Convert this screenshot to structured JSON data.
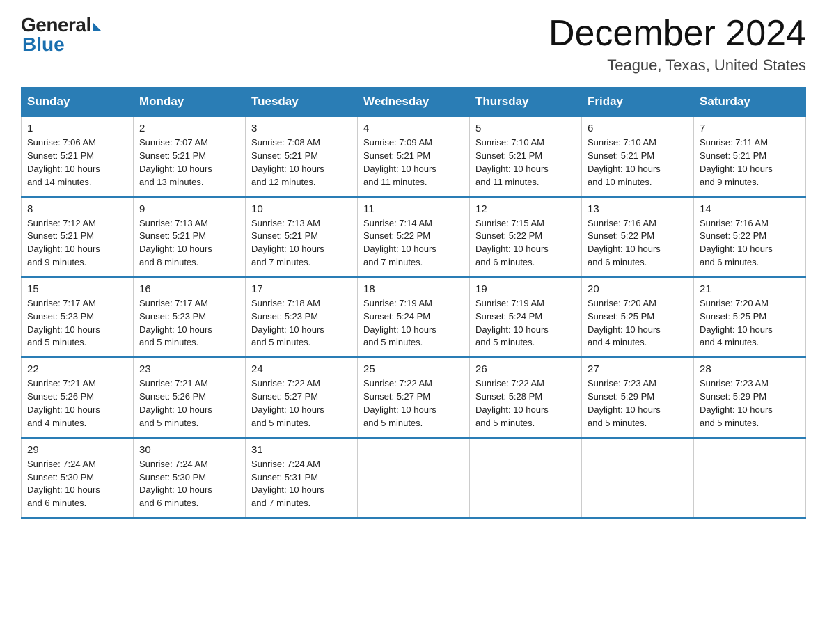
{
  "logo": {
    "general": "General",
    "blue": "Blue"
  },
  "header": {
    "month": "December 2024",
    "location": "Teague, Texas, United States"
  },
  "weekdays": [
    "Sunday",
    "Monday",
    "Tuesday",
    "Wednesday",
    "Thursday",
    "Friday",
    "Saturday"
  ],
  "weeks": [
    [
      {
        "day": "1",
        "sunrise": "7:06 AM",
        "sunset": "5:21 PM",
        "daylight": "10 hours and 14 minutes."
      },
      {
        "day": "2",
        "sunrise": "7:07 AM",
        "sunset": "5:21 PM",
        "daylight": "10 hours and 13 minutes."
      },
      {
        "day": "3",
        "sunrise": "7:08 AM",
        "sunset": "5:21 PM",
        "daylight": "10 hours and 12 minutes."
      },
      {
        "day": "4",
        "sunrise": "7:09 AM",
        "sunset": "5:21 PM",
        "daylight": "10 hours and 11 minutes."
      },
      {
        "day": "5",
        "sunrise": "7:10 AM",
        "sunset": "5:21 PM",
        "daylight": "10 hours and 11 minutes."
      },
      {
        "day": "6",
        "sunrise": "7:10 AM",
        "sunset": "5:21 PM",
        "daylight": "10 hours and 10 minutes."
      },
      {
        "day": "7",
        "sunrise": "7:11 AM",
        "sunset": "5:21 PM",
        "daylight": "10 hours and 9 minutes."
      }
    ],
    [
      {
        "day": "8",
        "sunrise": "7:12 AM",
        "sunset": "5:21 PM",
        "daylight": "10 hours and 9 minutes."
      },
      {
        "day": "9",
        "sunrise": "7:13 AM",
        "sunset": "5:21 PM",
        "daylight": "10 hours and 8 minutes."
      },
      {
        "day": "10",
        "sunrise": "7:13 AM",
        "sunset": "5:21 PM",
        "daylight": "10 hours and 7 minutes."
      },
      {
        "day": "11",
        "sunrise": "7:14 AM",
        "sunset": "5:22 PM",
        "daylight": "10 hours and 7 minutes."
      },
      {
        "day": "12",
        "sunrise": "7:15 AM",
        "sunset": "5:22 PM",
        "daylight": "10 hours and 6 minutes."
      },
      {
        "day": "13",
        "sunrise": "7:16 AM",
        "sunset": "5:22 PM",
        "daylight": "10 hours and 6 minutes."
      },
      {
        "day": "14",
        "sunrise": "7:16 AM",
        "sunset": "5:22 PM",
        "daylight": "10 hours and 6 minutes."
      }
    ],
    [
      {
        "day": "15",
        "sunrise": "7:17 AM",
        "sunset": "5:23 PM",
        "daylight": "10 hours and 5 minutes."
      },
      {
        "day": "16",
        "sunrise": "7:17 AM",
        "sunset": "5:23 PM",
        "daylight": "10 hours and 5 minutes."
      },
      {
        "day": "17",
        "sunrise": "7:18 AM",
        "sunset": "5:23 PM",
        "daylight": "10 hours and 5 minutes."
      },
      {
        "day": "18",
        "sunrise": "7:19 AM",
        "sunset": "5:24 PM",
        "daylight": "10 hours and 5 minutes."
      },
      {
        "day": "19",
        "sunrise": "7:19 AM",
        "sunset": "5:24 PM",
        "daylight": "10 hours and 5 minutes."
      },
      {
        "day": "20",
        "sunrise": "7:20 AM",
        "sunset": "5:25 PM",
        "daylight": "10 hours and 4 minutes."
      },
      {
        "day": "21",
        "sunrise": "7:20 AM",
        "sunset": "5:25 PM",
        "daylight": "10 hours and 4 minutes."
      }
    ],
    [
      {
        "day": "22",
        "sunrise": "7:21 AM",
        "sunset": "5:26 PM",
        "daylight": "10 hours and 4 minutes."
      },
      {
        "day": "23",
        "sunrise": "7:21 AM",
        "sunset": "5:26 PM",
        "daylight": "10 hours and 5 minutes."
      },
      {
        "day": "24",
        "sunrise": "7:22 AM",
        "sunset": "5:27 PM",
        "daylight": "10 hours and 5 minutes."
      },
      {
        "day": "25",
        "sunrise": "7:22 AM",
        "sunset": "5:27 PM",
        "daylight": "10 hours and 5 minutes."
      },
      {
        "day": "26",
        "sunrise": "7:22 AM",
        "sunset": "5:28 PM",
        "daylight": "10 hours and 5 minutes."
      },
      {
        "day": "27",
        "sunrise": "7:23 AM",
        "sunset": "5:29 PM",
        "daylight": "10 hours and 5 minutes."
      },
      {
        "day": "28",
        "sunrise": "7:23 AM",
        "sunset": "5:29 PM",
        "daylight": "10 hours and 5 minutes."
      }
    ],
    [
      {
        "day": "29",
        "sunrise": "7:24 AM",
        "sunset": "5:30 PM",
        "daylight": "10 hours and 6 minutes."
      },
      {
        "day": "30",
        "sunrise": "7:24 AM",
        "sunset": "5:30 PM",
        "daylight": "10 hours and 6 minutes."
      },
      {
        "day": "31",
        "sunrise": "7:24 AM",
        "sunset": "5:31 PM",
        "daylight": "10 hours and 7 minutes."
      },
      null,
      null,
      null,
      null
    ]
  ],
  "labels": {
    "sunrise": "Sunrise:",
    "sunset": "Sunset:",
    "daylight": "Daylight:"
  }
}
